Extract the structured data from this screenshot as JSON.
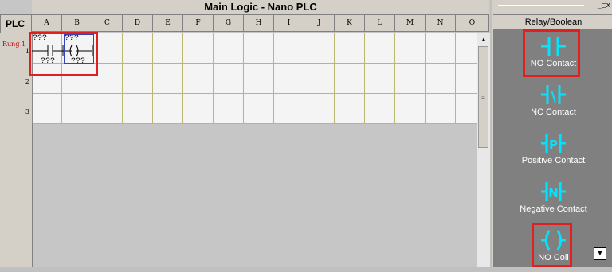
{
  "editor": {
    "title": "Main Logic - Nano PLC",
    "plc_label": "PLC",
    "columns": [
      "A",
      "B",
      "C",
      "D",
      "E",
      "F",
      "G",
      "H",
      "I",
      "J",
      "K",
      "L",
      "M",
      "N",
      "O"
    ],
    "rung_label": "Rung 1",
    "rung_numbers": [
      "1",
      "2",
      "3"
    ],
    "contact": {
      "top_tag": "???",
      "bottom_tag": "???"
    },
    "coil": {
      "top_tag": "???",
      "bottom_tag": "???"
    }
  },
  "palette": {
    "window_buttons": "_□x",
    "category": "Relay/Boolean",
    "items": [
      {
        "label": "NO Contact",
        "icon": "no-contact-icon"
      },
      {
        "label": "NC Contact",
        "icon": "nc-contact-icon"
      },
      {
        "label": "Positive Contact",
        "icon": "positive-contact-icon"
      },
      {
        "label": "Negative Contact",
        "icon": "negative-contact-icon"
      },
      {
        "label": "NO Coil",
        "icon": "no-coil-icon"
      }
    ],
    "colors": {
      "symbol": "#00e5ff",
      "highlight": "#e02020",
      "background": "#808080"
    }
  }
}
